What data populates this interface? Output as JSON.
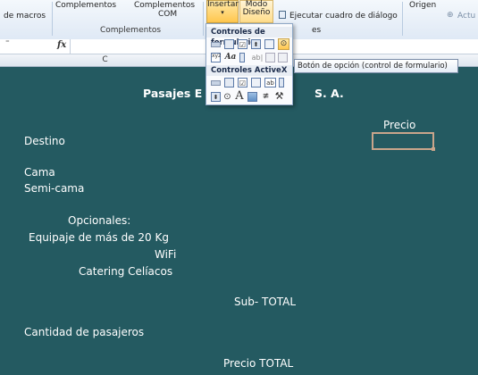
{
  "ribbon": {
    "macros_label": "de macros",
    "complementos_btn_1": "Complementos",
    "complementos_btn_2": "Complementos",
    "complementos_btn_2b": "COM",
    "complementos_group": "Complementos",
    "insertar_label": "Insertar",
    "modo_label_1": "Modo",
    "modo_label_2": "Diseño",
    "ejecutar_label": "Ejecutar cuadro de diálogo",
    "origen_label": "Origen",
    "actualizar_label": "Actu"
  },
  "formula_bar": {
    "fx": "fx"
  },
  "columns": {
    "c": "C"
  },
  "dropdown": {
    "form_controls_header": "Controles de formulario",
    "activex_header": "Controles ActiveX"
  },
  "tooltip": "Botón de opción (control de formulario)",
  "sheet": {
    "title_left": "Pasajes E",
    "title_right": "S. A.",
    "precio_header": "Precio",
    "destino": "Destino",
    "cama": "Cama",
    "semi_cama": "Semi-cama",
    "opcionales": "Opcionales:",
    "equipaje": "Equipaje de más de 20 Kg",
    "wifi": "WiFi",
    "catering": "Catering Celíacos",
    "subtotal": "Sub- TOTAL",
    "cantidad": "Cantidad de pasajeros",
    "precio_total": "Precio TOTAL"
  },
  "colors": {
    "sheet_bg": "#245a61",
    "selection_border": "#c9a58b",
    "insert_highlight": "#ffc64d"
  }
}
